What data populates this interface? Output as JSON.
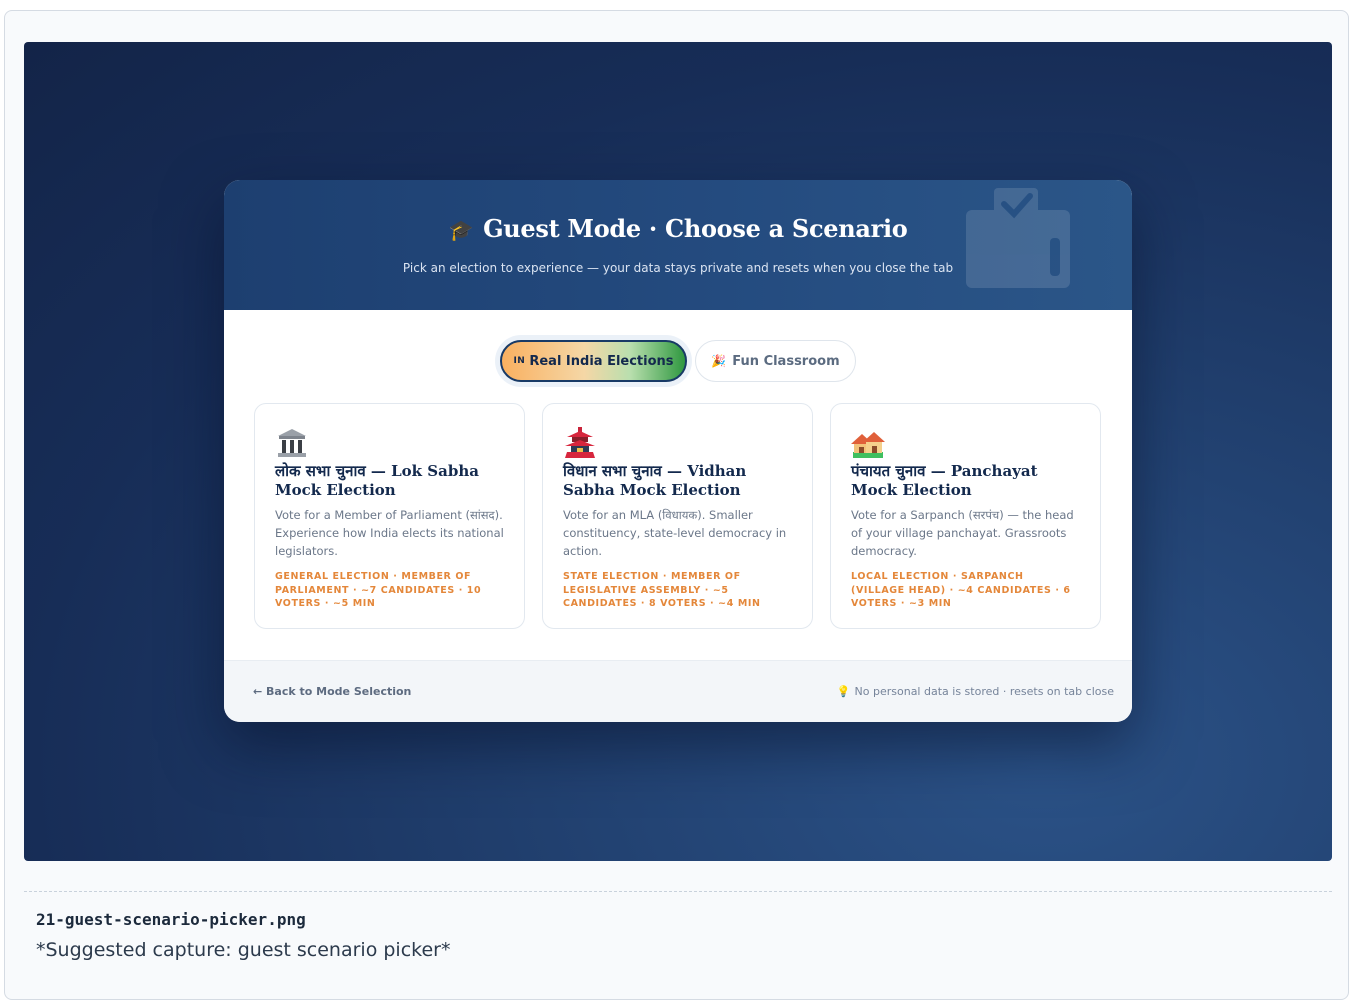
{
  "header": {
    "title": "Guest Mode · Choose a Scenario",
    "subtitle": "Pick an election to experience — your data stays private and resets when you close the tab"
  },
  "tabs": [
    {
      "label": "Real India Elections",
      "flag": "IN",
      "active": true
    },
    {
      "label": "Fun Classroom",
      "active": false
    }
  ],
  "scenarios": [
    {
      "icon": "classical-building-icon",
      "title": "लोक सभा चुनाव — Lok Sabha Mock Election",
      "description": "Vote for a Member of Parliament (सांसद). Experience how India elects its national legislators.",
      "meta": "General Election · Member of Parliament · ~7 candidates · 10 voters · ~5 min"
    },
    {
      "icon": "pagoda-icon",
      "title": "विधान सभा चुनाव — Vidhan Sabha Mock Election",
      "description": "Vote for an MLA (विधायक). Smaller constituency, state-level democracy in action.",
      "meta": "State Election · Member of Legislative Assembly · ~5 candidates · 8 voters · ~4 min"
    },
    {
      "icon": "houses-icon",
      "title": "पंचायत चुनाव — Panchayat Mock Election",
      "description": "Vote for a Sarpanch (सरपंच) — the head of your village panchayat. Grassroots democracy.",
      "meta": "Local Election · Sarpanch (Village Head) · ~4 candidates · 6 voters · ~3 min"
    }
  ],
  "footer": {
    "back_label": "← Back to Mode Selection",
    "privacy_note": "No personal data is stored · resets on tab close"
  },
  "caption": {
    "filename": "21-guest-scenario-picker.png",
    "note": "*Suggested capture: guest scenario picker*"
  },
  "colors": {
    "backdrop": "#172d57",
    "header": "#244b7f",
    "accent_orange": "#e4873a",
    "accent_green": "#2f9840",
    "navy_text": "#13294d"
  }
}
